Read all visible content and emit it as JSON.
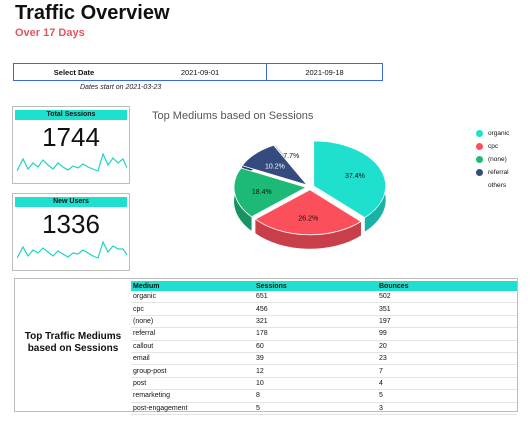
{
  "header": {
    "title": "Traffic Overview",
    "subtitle": "Over 17 Days"
  },
  "date_filter": {
    "label": "Select Date",
    "start": "2021-09-01",
    "end": "2021-09-18",
    "note": "Dates start on  2021-03-23"
  },
  "kpis": {
    "sessions": {
      "label": "Total Sessions",
      "value": "1744"
    },
    "new_users": {
      "label": "New Users",
      "value": "1336"
    }
  },
  "chart_data": {
    "type": "pie",
    "title": "Top Mediums based on Sessions",
    "labels": [
      "organic",
      "cpc",
      "(none)",
      "referral",
      "others"
    ],
    "values": [
      37.4,
      26.2,
      18.4,
      10.2,
      7.7
    ],
    "value_labels": [
      "37.4%",
      "26.2%",
      "18.4%",
      "10.2%",
      "7.7%"
    ],
    "colors": [
      "#1fe0cf",
      "#fb4f5b",
      "#1cb977",
      "#354a7f",
      "#ffffff"
    ],
    "legend_position": "right"
  },
  "sparkline_colors": {
    "line": "#1fd4c4"
  },
  "table": {
    "caption": "Top Traffic Mediums based on Sessions",
    "columns": [
      "Medium",
      "Sessions",
      "Bounces"
    ],
    "rows": [
      [
        "organic",
        "651",
        "502"
      ],
      [
        "cpc",
        "456",
        "351"
      ],
      [
        "(none)",
        "321",
        "197"
      ],
      [
        "referral",
        "178",
        "99"
      ],
      [
        "callout",
        "60",
        "20"
      ],
      [
        "email",
        "39",
        "23"
      ],
      [
        "group-post",
        "12",
        "7"
      ],
      [
        "post",
        "10",
        "4"
      ],
      [
        "remarketing",
        "8",
        "5"
      ],
      [
        "post-engagement",
        "5",
        "3"
      ]
    ]
  }
}
